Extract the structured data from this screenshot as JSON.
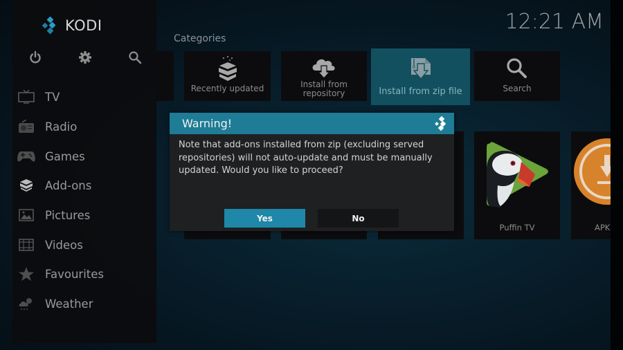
{
  "app": {
    "name": "KODI",
    "clock": "12:21 AM"
  },
  "colors": {
    "accent": "#1f7c96",
    "button_focus": "#1f87a8",
    "tile_focus": "#12505f",
    "apk_orange": "#d7832b"
  },
  "sidebar": {
    "top_icons": [
      {
        "name": "power",
        "icon": "power-icon"
      },
      {
        "name": "settings",
        "icon": "gear-icon"
      },
      {
        "name": "search",
        "icon": "search-icon"
      }
    ],
    "items": [
      {
        "label": "TV",
        "icon": "tv-icon"
      },
      {
        "label": "Radio",
        "icon": "radio-icon"
      },
      {
        "label": "Games",
        "icon": "gamepad-icon"
      },
      {
        "label": "Add-ons",
        "icon": "box-icon"
      },
      {
        "label": "Pictures",
        "icon": "picture-icon"
      },
      {
        "label": "Videos",
        "icon": "film-icon"
      },
      {
        "label": "Favourites",
        "icon": "star-icon"
      },
      {
        "label": "Weather",
        "icon": "weather-icon"
      }
    ]
  },
  "main": {
    "section_title": "Categories",
    "categories": [
      {
        "label": "",
        "icon": ""
      },
      {
        "label": "Recently updated",
        "icon": "open-box-icon"
      },
      {
        "label": "Install from\nrepository",
        "label_line1": "Install from",
        "label_line2": "repository",
        "icon": "cloud-download-icon"
      },
      {
        "label": "Install from zip file",
        "icon": "zip-install-icon",
        "focused": true
      },
      {
        "label": "Search",
        "icon": "search-icon"
      }
    ],
    "addons": [
      {
        "label": "Puffin TV",
        "icon": "puffin-icon"
      },
      {
        "label": "APK",
        "icon": "apk-download-icon"
      }
    ]
  },
  "dialog": {
    "title": "Warning!",
    "message": "Note that add-ons installed from zip (excluding served repositories) will not auto-update and must be manually updated. Would you like to proceed?",
    "buttons": {
      "yes": "Yes",
      "no": "No"
    },
    "focused_button": "yes"
  }
}
